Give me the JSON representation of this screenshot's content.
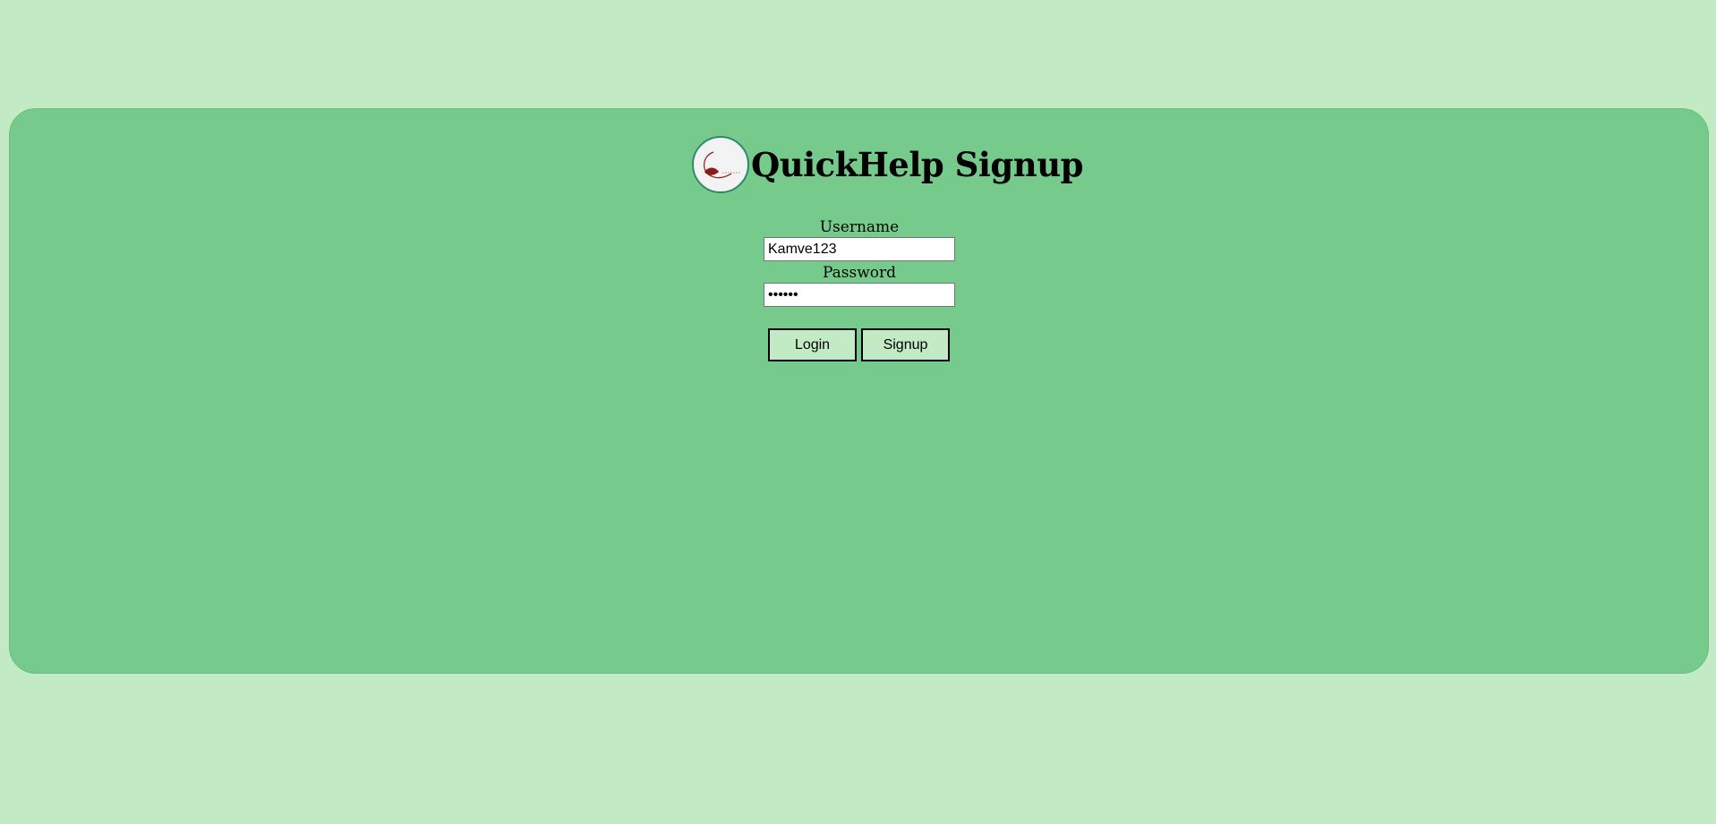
{
  "app": {
    "title": "QuickHelp Signup",
    "logo_icon": "quickhelp-logo-icon"
  },
  "form": {
    "username_label": "Username",
    "username_value": "Kamve123",
    "password_label": "Password",
    "password_value": "••••••"
  },
  "actions": {
    "login_label": "Login",
    "signup_label": "Signup"
  },
  "colors": {
    "page_background": "#c2ebc5",
    "card_background": "#76cb8c",
    "button_background": "#c2ebc5",
    "logo_accent": "#8b1a1a"
  }
}
